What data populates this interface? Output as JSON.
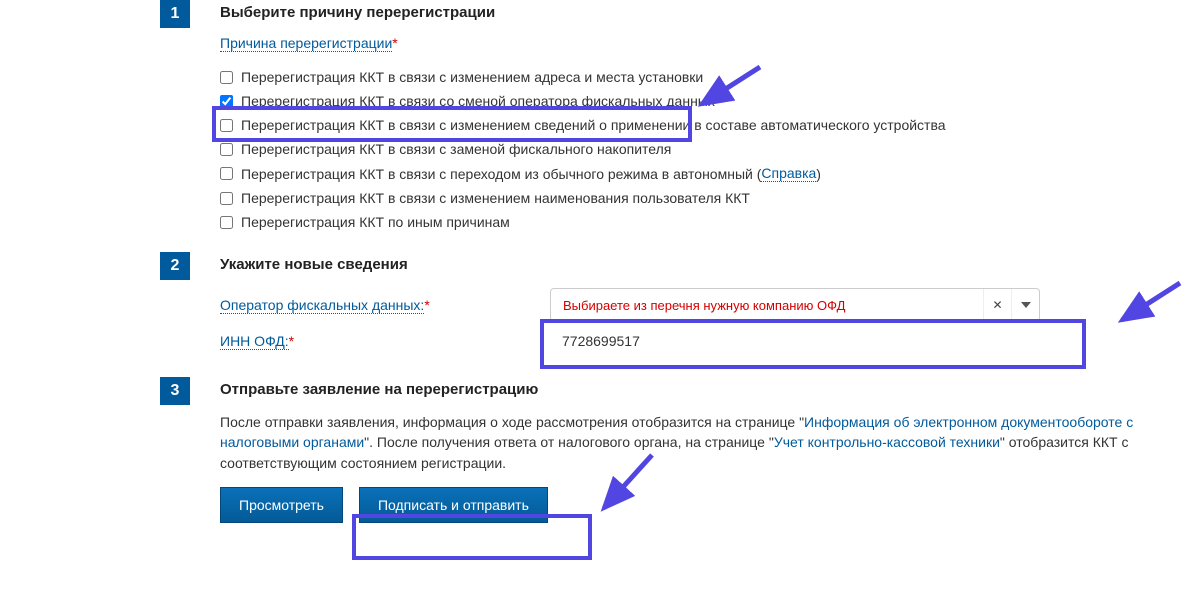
{
  "step1": {
    "num": "1",
    "title": "Выберите причину перерегистрации",
    "reason_link": "Причина перерегистрации",
    "help_label": "Справка",
    "reasons": [
      {
        "label": "Перерегистрация ККТ в связи с изменением адреса и места установки",
        "checked": false
      },
      {
        "label": "Перерегистрация ККТ в связи со сменой оператора фискальных данных",
        "checked": true
      },
      {
        "label": "Перерегистрация ККТ в связи с изменением сведений о применении в составе автоматического устройства",
        "checked": false
      },
      {
        "label": "Перерегистрация ККТ в связи с заменой фискального накопителя",
        "checked": false
      },
      {
        "label": "Перерегистрация ККТ в связи с переходом из обычного режима в автономный (",
        "checked": false,
        "has_help": true,
        "after": ")"
      },
      {
        "label": "Перерегистрация ККТ в связи с изменением наименования пользователя ККТ",
        "checked": false
      },
      {
        "label": "Перерегистрация ККТ по иным причинам",
        "checked": false
      }
    ]
  },
  "step2": {
    "num": "2",
    "title": "Укажите новые сведения",
    "operator_label": "Оператор фискальных данных:",
    "operator_value": "Выбираете из перечня нужную компанию ОФД",
    "inn_label": "ИНН ОФД:",
    "inn_value": "7728699517"
  },
  "step3": {
    "num": "3",
    "title": "Отправьте заявление на перерегистрацию",
    "desc_1": "После отправки заявления, информация о ходе рассмотрения отобразится на странице \"",
    "link_1": "Информация об электронном документообороте с налоговыми органами",
    "desc_2": "\". После получения ответа от налогового органа, на странице \"",
    "link_2": "Учет контрольно-кассовой техники",
    "desc_3": "\" отобразится ККТ с соответствующим состоянием регистрации.",
    "btn_preview": "Просмотреть",
    "btn_submit": "Подписать и отправить"
  }
}
